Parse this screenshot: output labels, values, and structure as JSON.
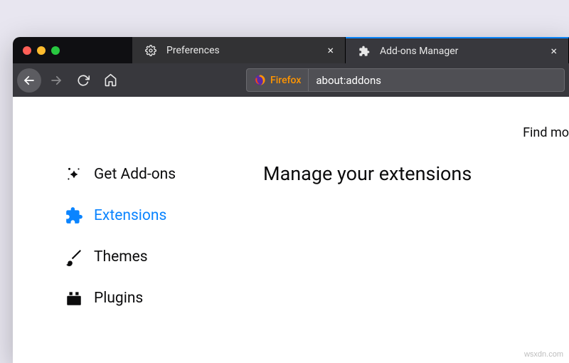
{
  "tabs": [
    {
      "label": "Preferences",
      "active": false
    },
    {
      "label": "Add-ons Manager",
      "active": true
    }
  ],
  "urlbar": {
    "brand": "Firefox",
    "address": "about:addons"
  },
  "sidebar": {
    "items": [
      {
        "label": "Get Add-ons"
      },
      {
        "label": "Extensions"
      },
      {
        "label": "Themes"
      },
      {
        "label": "Plugins"
      }
    ]
  },
  "main": {
    "heading": "Manage your extensions",
    "find_more": "Find mo"
  },
  "watermark": "wsxdn.com"
}
